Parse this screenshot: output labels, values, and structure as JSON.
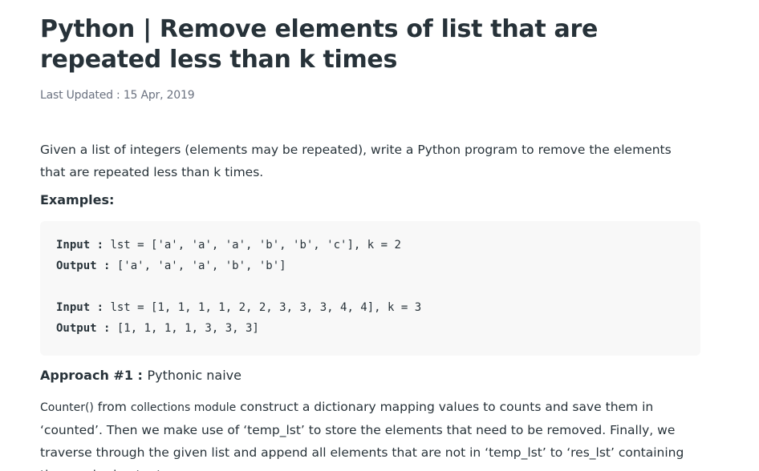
{
  "article": {
    "title": "Python | Remove elements of list that are repeated less than k times",
    "last_updated": "Last Updated : 15 Apr, 2019",
    "intro": "Given a list of integers (elements may be repeated), write a Python program to remove the elements that are repeated less than k times.",
    "examples_heading": "Examples:",
    "code": {
      "line1_label": "Input : ",
      "line1_value": "lst = ['a', 'a', 'a', 'b', 'b', 'c'], k = 2",
      "line2_label": "Output : ",
      "line2_value": "['a', 'a', 'a', 'b', 'b']",
      "line3_label": "Input : ",
      "line3_value": "lst = [1, 1, 1, 1, 2, 2, 3, 3, 3, 4, 4], k = 3",
      "line4_label": "Output : ",
      "line4_value": "[1, 1, 1, 1, 3, 3, 3]"
    },
    "approach_label": "Approach #1 : ",
    "approach_name": "Pythonic naive",
    "body": {
      "counter": "Counter()",
      "from": " from ",
      "collections": "collections",
      "module": " module",
      "rest": " construct a dictionary mapping values to counts and save them in ‘counted’. Then we make use of ‘temp_lst’ to store the elements that need to be removed. Finally, we traverse through the given list and append all elements that are not in ‘temp_lst’ to ‘res_lst’ containing the required output."
    }
  }
}
